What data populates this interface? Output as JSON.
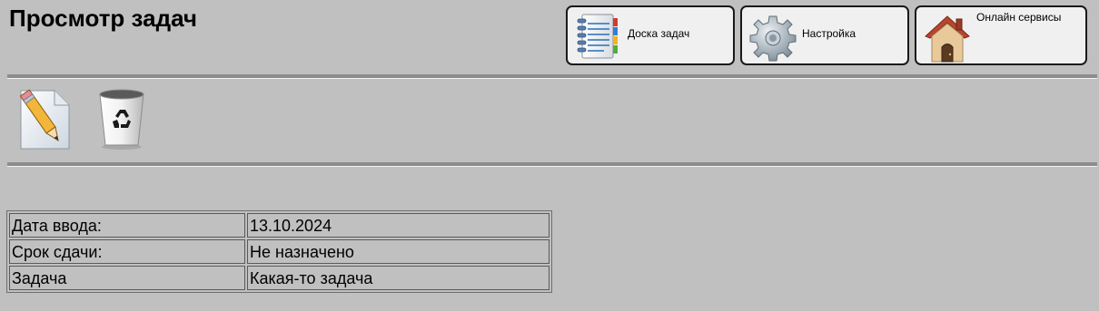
{
  "page": {
    "title": "Просмотр задач"
  },
  "nav": {
    "board_label": "Доска задач",
    "settings_label": "Настройка",
    "online_label": "Онлайн сервисы",
    "board_icon": "notebook-icon",
    "settings_icon": "gear-icon",
    "online_icon": "house-icon"
  },
  "toolbar": {
    "edit_icon": "edit-pencil-icon",
    "delete_icon": "trash-bin-icon"
  },
  "task_details": {
    "rows": [
      {
        "label": "Дата ввода:",
        "value": "13.10.2024"
      },
      {
        "label": "Срок сдачи:",
        "value": "Не назначено"
      },
      {
        "label": "Задача",
        "value": "Какая-то задача"
      }
    ]
  }
}
